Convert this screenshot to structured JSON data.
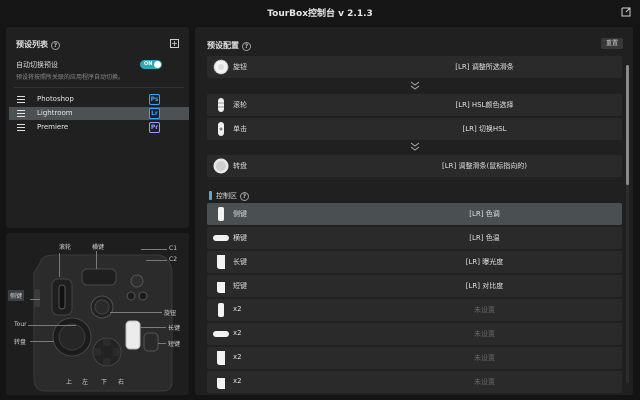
{
  "window": {
    "title": "TourBox控制台 v 2.1.3"
  },
  "preset_panel": {
    "title": "预设列表",
    "help": "?",
    "add": "+",
    "auto_switch_label": "自动切换预设",
    "auto_switch_desc": "预设将按照所关联的应用程序自动切换。",
    "toggle_label": "ON",
    "toggle_on": true,
    "items": [
      {
        "name": "Photoshop",
        "app": "Ps",
        "color": "#31a8ff",
        "selected": false
      },
      {
        "name": "Lightroom",
        "app": "Lr",
        "color": "#31a8ff",
        "selected": true
      },
      {
        "name": "Premiere",
        "app": "Pr",
        "color": "#9999ff",
        "selected": false
      }
    ]
  },
  "config_panel": {
    "title": "预设配置",
    "help": "?",
    "reset": "重置",
    "group1": [
      {
        "icon": "knob-icon",
        "name": "旋钮",
        "action": "[LR] 调整所选滑条",
        "set": true
      },
      {
        "icon": "scroll-icon",
        "name": "滚轮",
        "action": "[LR] HSL颜色选择",
        "set": true
      },
      {
        "icon": "scroll-click-icon",
        "name": "单击",
        "action": "[LR] 切换HSL",
        "set": true
      },
      {
        "icon": "dial-icon",
        "name": "转盘",
        "action": "[LR] 调整滑条(鼠标指向的)",
        "set": true
      }
    ],
    "control_zone": {
      "title": "控制区",
      "help": "?"
    },
    "group2": [
      {
        "icon": "side-key-icon",
        "name": "侧键",
        "action": "[LR] 色调",
        "set": true,
        "highlight": true
      },
      {
        "icon": "flat-key-icon",
        "name": "横键",
        "action": "[LR] 色温",
        "set": true,
        "highlight": false
      },
      {
        "icon": "tall-key-icon",
        "name": "长键",
        "action": "[LR] 曝光度",
        "set": true,
        "highlight": false
      },
      {
        "icon": "short-key-icon",
        "name": "短键",
        "action": "[LR] 对比度",
        "set": true,
        "highlight": false
      },
      {
        "icon": "side-key-icon",
        "name": "x2",
        "action": "未设置",
        "set": false,
        "highlight": false
      },
      {
        "icon": "flat-key-icon",
        "name": "x2",
        "action": "未设置",
        "set": false,
        "highlight": false
      },
      {
        "icon": "tall-key-icon",
        "name": "x2",
        "action": "未设置",
        "set": false,
        "highlight": false
      },
      {
        "icon": "short-key-icon",
        "name": "x2",
        "action": "未设置",
        "set": false,
        "highlight": false
      }
    ]
  },
  "device": {
    "labels": {
      "scroll": "滚轮",
      "flat": "横键",
      "c1": "C1",
      "c2": "C2",
      "side": "侧键",
      "knob": "旋钮",
      "tall": "长键",
      "tour": "Tour",
      "dial": "转盘",
      "short": "短键",
      "up": "上",
      "left": "左",
      "down": "下",
      "right": "右"
    }
  }
}
